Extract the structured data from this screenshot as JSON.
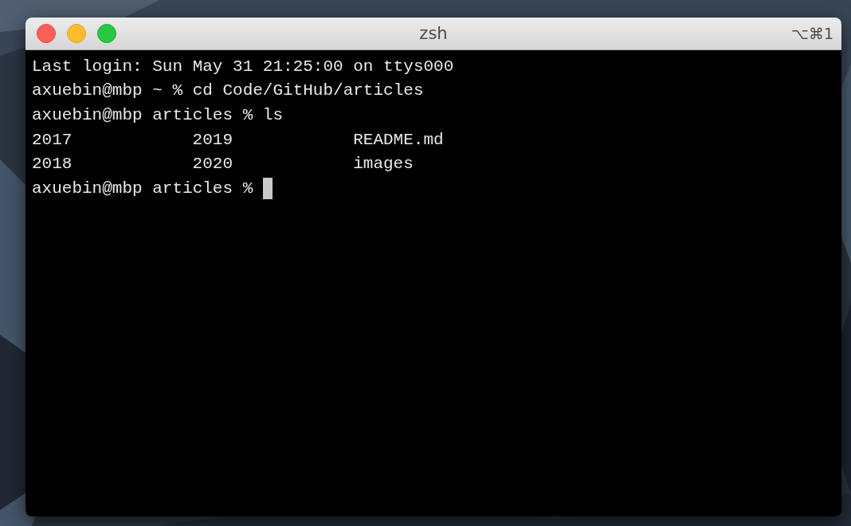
{
  "window": {
    "title": "zsh",
    "shortcut": "⌥⌘1"
  },
  "terminal": {
    "lines": [
      {
        "kind": "text",
        "text": "Last login: Sun May 31 21:25:00 on ttys000"
      },
      {
        "kind": "text",
        "text": "axuebin@mbp ~ % cd Code/GitHub/articles"
      },
      {
        "kind": "text",
        "text": "axuebin@mbp articles % ls"
      },
      {
        "kind": "columns",
        "cells": [
          "2017",
          "2019",
          "README.md"
        ]
      },
      {
        "kind": "columns",
        "cells": [
          "2018",
          "2020",
          "images"
        ]
      },
      {
        "kind": "prompt",
        "text": "axuebin@mbp articles %"
      }
    ]
  }
}
